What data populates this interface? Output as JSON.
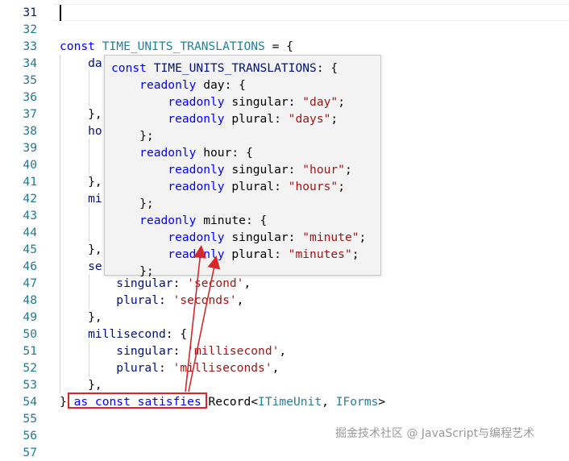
{
  "editor": {
    "line_numbers": [
      "31",
      "32",
      "33",
      "34",
      "35",
      "36",
      "37",
      "38",
      "39",
      "40",
      "41",
      "42",
      "43",
      "44",
      "45",
      "46",
      "47",
      "48",
      "49",
      "50",
      "51",
      "52",
      "53",
      "54",
      "55",
      "56",
      "57"
    ],
    "code_lines": [
      {
        "tokens": []
      },
      {
        "tokens": []
      },
      {
        "tokens": [
          {
            "t": "const ",
            "c": "kw"
          },
          {
            "t": "TIME_UNITS_TRANSLATIONS",
            "c": "ty"
          },
          {
            "t": " = {",
            "c": "pl"
          }
        ]
      },
      {
        "tokens": [
          {
            "t": "    da",
            "c": "id"
          }
        ]
      },
      {
        "tokens": []
      },
      {
        "tokens": []
      },
      {
        "tokens": [
          {
            "t": "    },",
            "c": "pl"
          }
        ]
      },
      {
        "tokens": [
          {
            "t": "    ho",
            "c": "id"
          }
        ]
      },
      {
        "tokens": []
      },
      {
        "tokens": []
      },
      {
        "tokens": [
          {
            "t": "    },",
            "c": "pl"
          }
        ]
      },
      {
        "tokens": [
          {
            "t": "    mi",
            "c": "id"
          }
        ]
      },
      {
        "tokens": []
      },
      {
        "tokens": []
      },
      {
        "tokens": [
          {
            "t": "    },",
            "c": "pl"
          }
        ]
      },
      {
        "tokens": [
          {
            "t": "    se",
            "c": "id"
          }
        ]
      },
      {
        "tokens": [
          {
            "t": "        singular",
            "c": "id"
          },
          {
            "t": ": ",
            "c": "pl"
          },
          {
            "t": "'second'",
            "c": "str"
          },
          {
            "t": ",",
            "c": "pl"
          }
        ]
      },
      {
        "tokens": [
          {
            "t": "        plural",
            "c": "id"
          },
          {
            "t": ": ",
            "c": "pl"
          },
          {
            "t": "'seconds'",
            "c": "str"
          },
          {
            "t": ",",
            "c": "pl"
          }
        ]
      },
      {
        "tokens": [
          {
            "t": "    },",
            "c": "pl"
          }
        ]
      },
      {
        "tokens": [
          {
            "t": "    millisecond",
            "c": "id"
          },
          {
            "t": ": {",
            "c": "pl"
          }
        ]
      },
      {
        "tokens": [
          {
            "t": "        singular",
            "c": "id"
          },
          {
            "t": ": ",
            "c": "pl"
          },
          {
            "t": "'millisecond'",
            "c": "str"
          },
          {
            "t": ",",
            "c": "pl"
          }
        ]
      },
      {
        "tokens": [
          {
            "t": "        plural",
            "c": "id"
          },
          {
            "t": ": ",
            "c": "pl"
          },
          {
            "t": "'milliseconds'",
            "c": "str"
          },
          {
            "t": ",",
            "c": "pl"
          }
        ]
      },
      {
        "tokens": [
          {
            "t": "    },",
            "c": "pl"
          }
        ]
      },
      {
        "tokens": [
          {
            "t": "} ",
            "c": "pl"
          },
          {
            "t": "as const satisfies",
            "c": "kw"
          },
          {
            "t": " Record<",
            "c": "pl"
          },
          {
            "t": "ITimeUnit",
            "c": "ty"
          },
          {
            "t": ", ",
            "c": "pl"
          },
          {
            "t": "IForms",
            "c": "ty"
          },
          {
            "t": ">",
            "c": "pl"
          }
        ]
      },
      {
        "tokens": []
      },
      {
        "tokens": []
      },
      {
        "tokens": []
      }
    ]
  },
  "hover_tooltip": {
    "lines": [
      [
        {
          "t": "const ",
          "c": "kw"
        },
        {
          "t": "TIME_UNITS_TRANSLATIONS",
          "c": "tid"
        },
        {
          "t": ": {",
          "c": "pl"
        }
      ],
      [
        {
          "t": "    ",
          "c": "pl"
        },
        {
          "t": "readonly",
          "c": "kw"
        },
        {
          "t": " day: {",
          "c": "pl"
        }
      ],
      [
        {
          "t": "        ",
          "c": "pl"
        },
        {
          "t": "readonly",
          "c": "kw"
        },
        {
          "t": " singular: ",
          "c": "pl"
        },
        {
          "t": "\"day\"",
          "c": "tstr"
        },
        {
          "t": ";",
          "c": "pl"
        }
      ],
      [
        {
          "t": "        ",
          "c": "pl"
        },
        {
          "t": "readonly",
          "c": "kw"
        },
        {
          "t": " plural: ",
          "c": "pl"
        },
        {
          "t": "\"days\"",
          "c": "tstr"
        },
        {
          "t": ";",
          "c": "pl"
        }
      ],
      [
        {
          "t": "    };",
          "c": "pl"
        }
      ],
      [
        {
          "t": "    ",
          "c": "pl"
        },
        {
          "t": "readonly",
          "c": "kw"
        },
        {
          "t": " hour: {",
          "c": "pl"
        }
      ],
      [
        {
          "t": "        ",
          "c": "pl"
        },
        {
          "t": "readonly",
          "c": "kw"
        },
        {
          "t": " singular: ",
          "c": "pl"
        },
        {
          "t": "\"hour\"",
          "c": "tstr"
        },
        {
          "t": ";",
          "c": "pl"
        }
      ],
      [
        {
          "t": "        ",
          "c": "pl"
        },
        {
          "t": "readonly",
          "c": "kw"
        },
        {
          "t": " plural: ",
          "c": "pl"
        },
        {
          "t": "\"hours\"",
          "c": "tstr"
        },
        {
          "t": ";",
          "c": "pl"
        }
      ],
      [
        {
          "t": "    };",
          "c": "pl"
        }
      ],
      [
        {
          "t": "    ",
          "c": "pl"
        },
        {
          "t": "readonly",
          "c": "kw"
        },
        {
          "t": " minute: {",
          "c": "pl"
        }
      ],
      [
        {
          "t": "        ",
          "c": "pl"
        },
        {
          "t": "readonly",
          "c": "kw"
        },
        {
          "t": " singular: ",
          "c": "pl"
        },
        {
          "t": "\"minute\"",
          "c": "tstr"
        },
        {
          "t": ";",
          "c": "pl"
        }
      ],
      [
        {
          "t": "        ",
          "c": "pl"
        },
        {
          "t": "readonly",
          "c": "kw"
        },
        {
          "t": " plural: ",
          "c": "pl"
        },
        {
          "t": "\"minutes\"",
          "c": "tstr"
        },
        {
          "t": ";",
          "c": "pl"
        }
      ],
      [
        {
          "t": "    };",
          "c": "pl"
        }
      ]
    ]
  },
  "annotation": {
    "highlight_color": "#d9262a"
  },
  "watermark": {
    "text": "掘金技术社区 @ JavaScript与编程艺术"
  },
  "colors": {
    "keyword": "#0000ff",
    "identifier": "#001080",
    "type": "#267f99",
    "string": "#a31515",
    "line_number": "#237893"
  }
}
